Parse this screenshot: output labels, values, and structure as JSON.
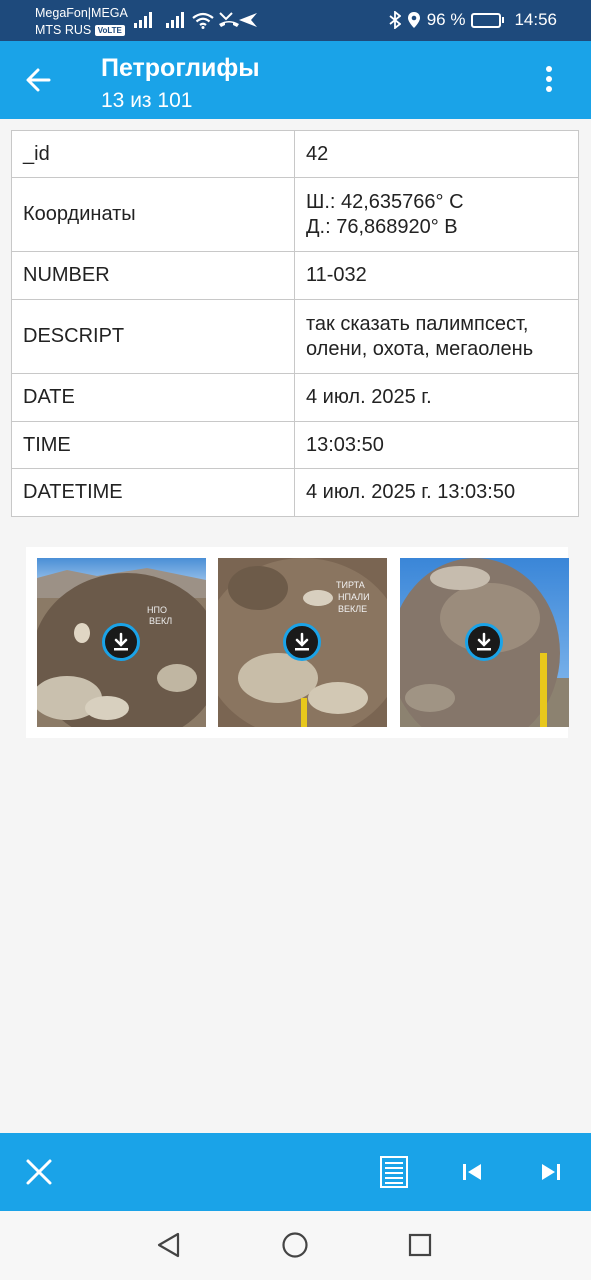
{
  "status": {
    "carrier1": "MegaFon|MEGA",
    "carrier2": "MTS RUS",
    "volte": "VoLTE",
    "battery_percent": "96 %",
    "battery_level": 0.96,
    "time": "14:56"
  },
  "app_bar": {
    "title": "Петроглифы",
    "subtitle": "13 из 101"
  },
  "properties": [
    {
      "key": "_id",
      "value": "42"
    },
    {
      "key": "Координаты",
      "value": "Ш.: 42,635766° С\nД.: 76,868920° В"
    },
    {
      "key": "NUMBER",
      "value": "11-032"
    },
    {
      "key": "DESCRIPT",
      "value": "так сказать палимпсест,\nолени, охота, мегаолень"
    },
    {
      "key": "DATE",
      "value": "4 июл. 2025 г."
    },
    {
      "key": "TIME",
      "value": "13:03:50"
    },
    {
      "key": "DATETIME",
      "value": "4 июл. 2025 г. 13:03:50"
    }
  ],
  "photos": [
    {
      "name": "rock-photo-1"
    },
    {
      "name": "rock-photo-2"
    },
    {
      "name": "rock-photo-3"
    }
  ],
  "icons": {
    "back": "arrow-back-icon",
    "more": "more-vert-icon",
    "close": "close-icon",
    "list": "document-list-icon",
    "first": "skip-first-icon",
    "last": "skip-last-icon",
    "download": "download-icon"
  },
  "colors": {
    "status_bar": "#1e4a7c",
    "app_bar": "#1aa3e8",
    "background": "#f5f5f5"
  }
}
